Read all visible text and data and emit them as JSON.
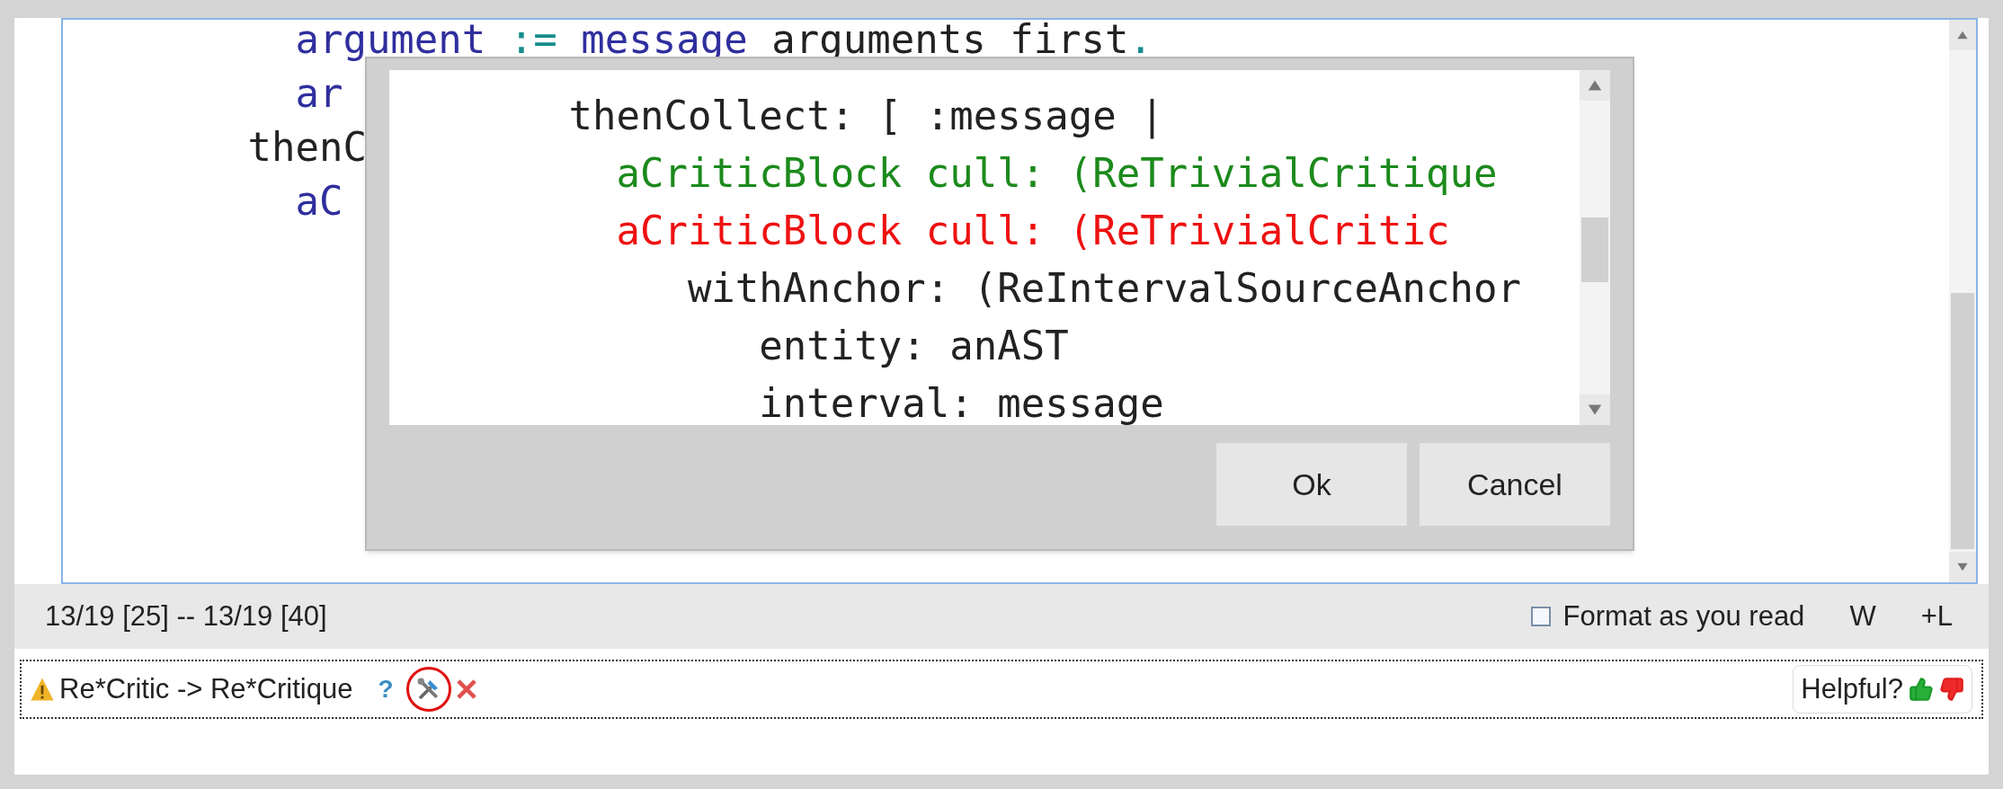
{
  "editor": {
    "lines": [
      {
        "tokens": [
          {
            "text": "         argument",
            "color": "#2f2f9e"
          },
          {
            "text": " := ",
            "color": "#168c8c"
          },
          {
            "text": "message",
            "color": "#2f2f9e"
          },
          {
            "text": " arguments first",
            "color": "#222222"
          },
          {
            "text": ".",
            "color": "#168c8c"
          }
        ]
      },
      {
        "tokens": [
          {
            "text": "         ar",
            "color": "#2f2f9e"
          }
        ]
      },
      {
        "tokens": [
          {
            "text": "       thenC",
            "color": "#222222"
          }
        ]
      },
      {
        "tokens": [
          {
            "text": "         aC",
            "color": "#2f2f9e"
          }
        ]
      }
    ]
  },
  "dialog": {
    "lines": [
      {
        "tokens": [
          {
            "text": "       thenCollect: [ :message |",
            "color": "#222222"
          }
        ]
      },
      {
        "tokens": [
          {
            "text": "         aCriticBlock cull: (ReTrivialCritique",
            "color": "#1c8a1c"
          }
        ]
      },
      {
        "tokens": [
          {
            "text": "         aCriticBlock cull: (ReTrivialCritic",
            "color": "#ee1111"
          }
        ]
      },
      {
        "tokens": [
          {
            "text": "            withAnchor: (ReIntervalSourceAnchor",
            "color": "#222222"
          }
        ]
      },
      {
        "tokens": [
          {
            "text": "               entity: anAST",
            "color": "#222222"
          }
        ]
      },
      {
        "tokens": [
          {
            "text": "               interval: message",
            "color": "#222222"
          }
        ]
      }
    ],
    "buttons": [
      "Ok",
      "Cancel"
    ]
  },
  "status_bar": {
    "position": "13/19 [25] -- 13/19 [40]",
    "format_checkbox": {
      "label": "Format as you read",
      "checked": false
    },
    "toggles": [
      "W",
      "+L"
    ]
  },
  "critique": {
    "text": "Re*Critic -> Re*Critique",
    "help": "?",
    "helpful": "Helpful?"
  }
}
